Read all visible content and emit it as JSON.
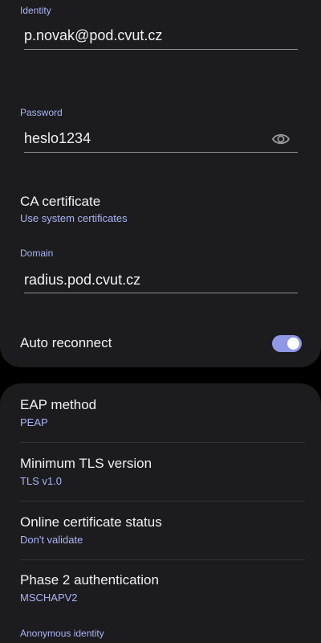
{
  "identity": {
    "label": "Identity",
    "value": "p.novak@pod.cvut.cz"
  },
  "password": {
    "label": "Password",
    "value": "heslo1234",
    "toggle_icon": "eye-icon"
  },
  "ca_certificate": {
    "title": "CA certificate",
    "value": "Use system certificates"
  },
  "domain": {
    "label": "Domain",
    "value": "radius.pod.cvut.cz"
  },
  "auto_reconnect": {
    "label": "Auto reconnect",
    "enabled": true
  },
  "eap_method": {
    "title": "EAP method",
    "value": "PEAP"
  },
  "min_tls": {
    "title": "Minimum TLS version",
    "value": "TLS v1.0"
  },
  "online_cert_status": {
    "title": "Online certificate status",
    "value": "Don't validate"
  },
  "phase2": {
    "title": "Phase 2 authentication",
    "value": "MSCHAPV2"
  },
  "anonymous_identity": {
    "label": "Anonymous identity"
  },
  "colors": {
    "background": "#000000",
    "card": "#1c1c1e",
    "accent": "#a9b4f5",
    "toggle_on": "#8f97e6",
    "text_primary": "#f2f2f4"
  }
}
